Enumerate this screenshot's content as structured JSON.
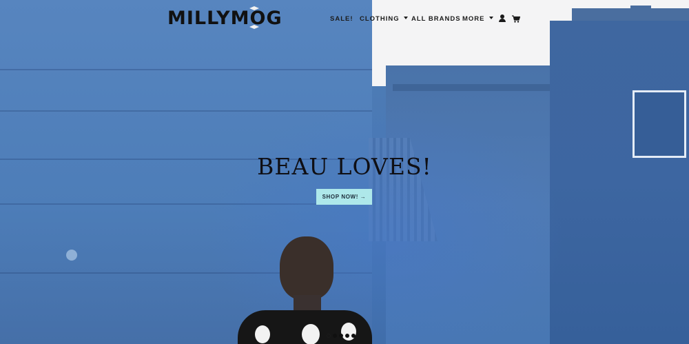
{
  "brand": {
    "logo_text": "MILLYMOG"
  },
  "nav": {
    "items": [
      {
        "label": "SALE!",
        "has_dropdown": false
      },
      {
        "label": "CLOTHING",
        "has_dropdown": true
      },
      {
        "label": "ALL BRANDS",
        "has_dropdown": false
      },
      {
        "label": "MORE",
        "has_dropdown": true
      }
    ],
    "icons": [
      "account-icon",
      "cart-icon"
    ]
  },
  "hero": {
    "title": "BEAU LOVES!",
    "button_label": "SHOP NOW! →",
    "button_color": "#aee8ea",
    "slides_total": 5,
    "active_slide": 1
  },
  "colors": {
    "text_dark": "#111111",
    "background_blue": "#4f7fb8"
  }
}
